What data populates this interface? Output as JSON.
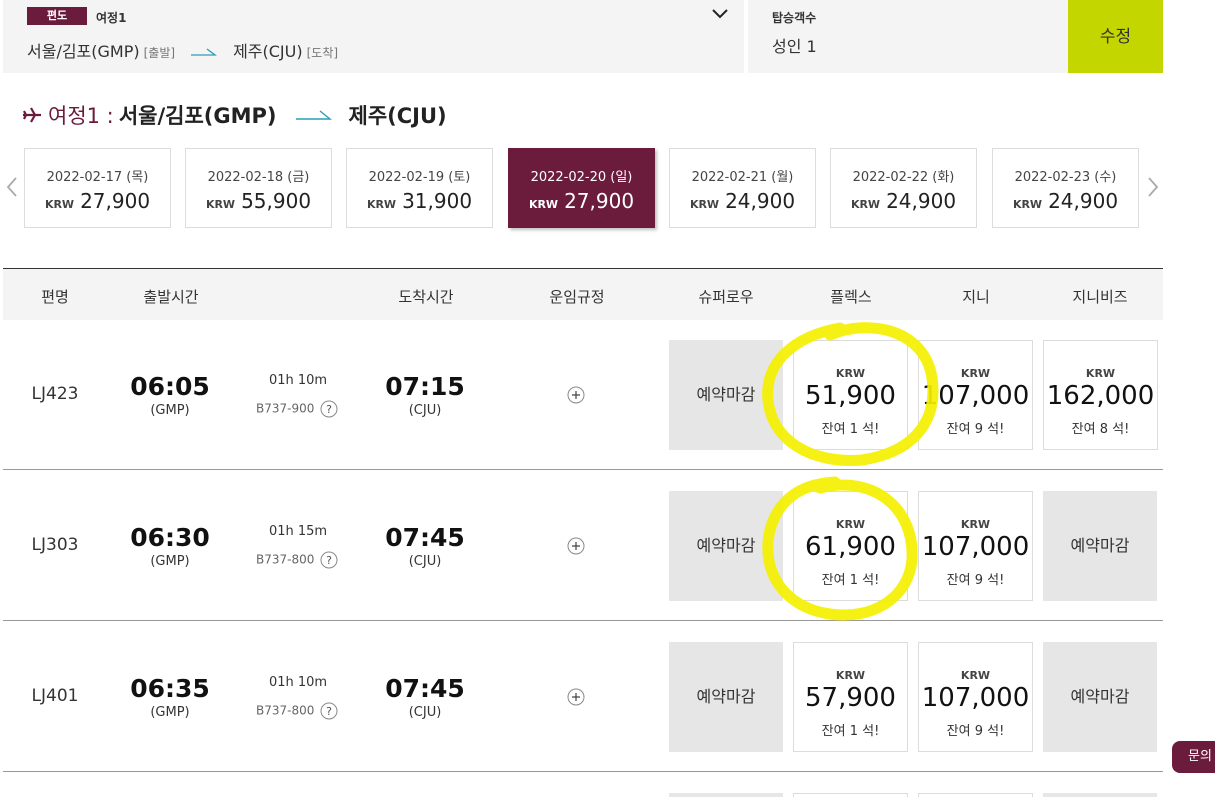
{
  "search": {
    "trip_type": "편도",
    "trip_label": "여정1",
    "origin": "서울/김포(GMP)",
    "origin_tag": "[출발]",
    "destination": "제주(CJU)",
    "destination_tag": "[도착]",
    "passengers_label": "탑승객수",
    "passengers_value": "성인 1",
    "edit_label": "수정"
  },
  "itinerary": {
    "label": "여정1 :",
    "origin": "서울/김포(GMP)",
    "destination": "제주(CJU)"
  },
  "dates": [
    {
      "date": "2022-02-17 (목)",
      "currency": "KRW",
      "price": "27,900"
    },
    {
      "date": "2022-02-18 (금)",
      "currency": "KRW",
      "price": "55,900"
    },
    {
      "date": "2022-02-19 (토)",
      "currency": "KRW",
      "price": "31,900"
    },
    {
      "date": "2022-02-20 (일)",
      "currency": "KRW",
      "price": "27,900",
      "selected": true
    },
    {
      "date": "2022-02-21 (월)",
      "currency": "KRW",
      "price": "24,900"
    },
    {
      "date": "2022-02-22 (화)",
      "currency": "KRW",
      "price": "24,900"
    },
    {
      "date": "2022-02-23 (수)",
      "currency": "KRW",
      "price": "24,900"
    }
  ],
  "table": {
    "headers": [
      "편명",
      "출발시간",
      "도착시간",
      "운임규정",
      "슈퍼로우",
      "플렉스",
      "지니",
      "지니비즈"
    ],
    "closed_label": "예약마감",
    "flights": [
      {
        "flight": "LJ423",
        "dep_time": "06:05",
        "dep_airport": "(GMP)",
        "duration": "01h 10m",
        "aircraft": "B737-900",
        "arr_time": "07:15",
        "arr_airport": "(CJU)",
        "fares": {
          "super_low": null,
          "flex": {
            "currency": "KRW",
            "price": "51,900",
            "seats": "잔여 1 석!"
          },
          "jini": {
            "currency": "KRW",
            "price": "107,000",
            "seats": "잔여 9 석!"
          },
          "jini_biz": {
            "currency": "KRW",
            "price": "162,000",
            "seats": "잔여 8 석!"
          }
        }
      },
      {
        "flight": "LJ303",
        "dep_time": "06:30",
        "dep_airport": "(GMP)",
        "duration": "01h 15m",
        "aircraft": "B737-800",
        "arr_time": "07:45",
        "arr_airport": "(CJU)",
        "fares": {
          "super_low": null,
          "flex": {
            "currency": "KRW",
            "price": "61,900",
            "seats": "잔여 1 석!"
          },
          "jini": {
            "currency": "KRW",
            "price": "107,000",
            "seats": "잔여 9 석!"
          },
          "jini_biz": null
        }
      },
      {
        "flight": "LJ401",
        "dep_time": "06:35",
        "dep_airport": "(GMP)",
        "duration": "01h 10m",
        "aircraft": "B737-800",
        "arr_time": "07:45",
        "arr_airport": "(CJU)",
        "fares": {
          "super_low": null,
          "flex": {
            "currency": "KRW",
            "price": "57,900",
            "seats": "잔여 1 석!"
          },
          "jini": {
            "currency": "KRW",
            "price": "107,000",
            "seats": "잔여 9 석!"
          },
          "jini_biz": null
        }
      }
    ]
  },
  "inquiry_label": "문의",
  "colors": {
    "brand": "#6b1b3c",
    "accent": "#c4d600",
    "highlight": "#f5f000"
  },
  "icons": [
    "chevron-down-icon",
    "plane-icon",
    "route-arrow-icon",
    "prev-arrow-icon",
    "next-arrow-icon",
    "question-icon",
    "plus-circle-icon"
  ]
}
